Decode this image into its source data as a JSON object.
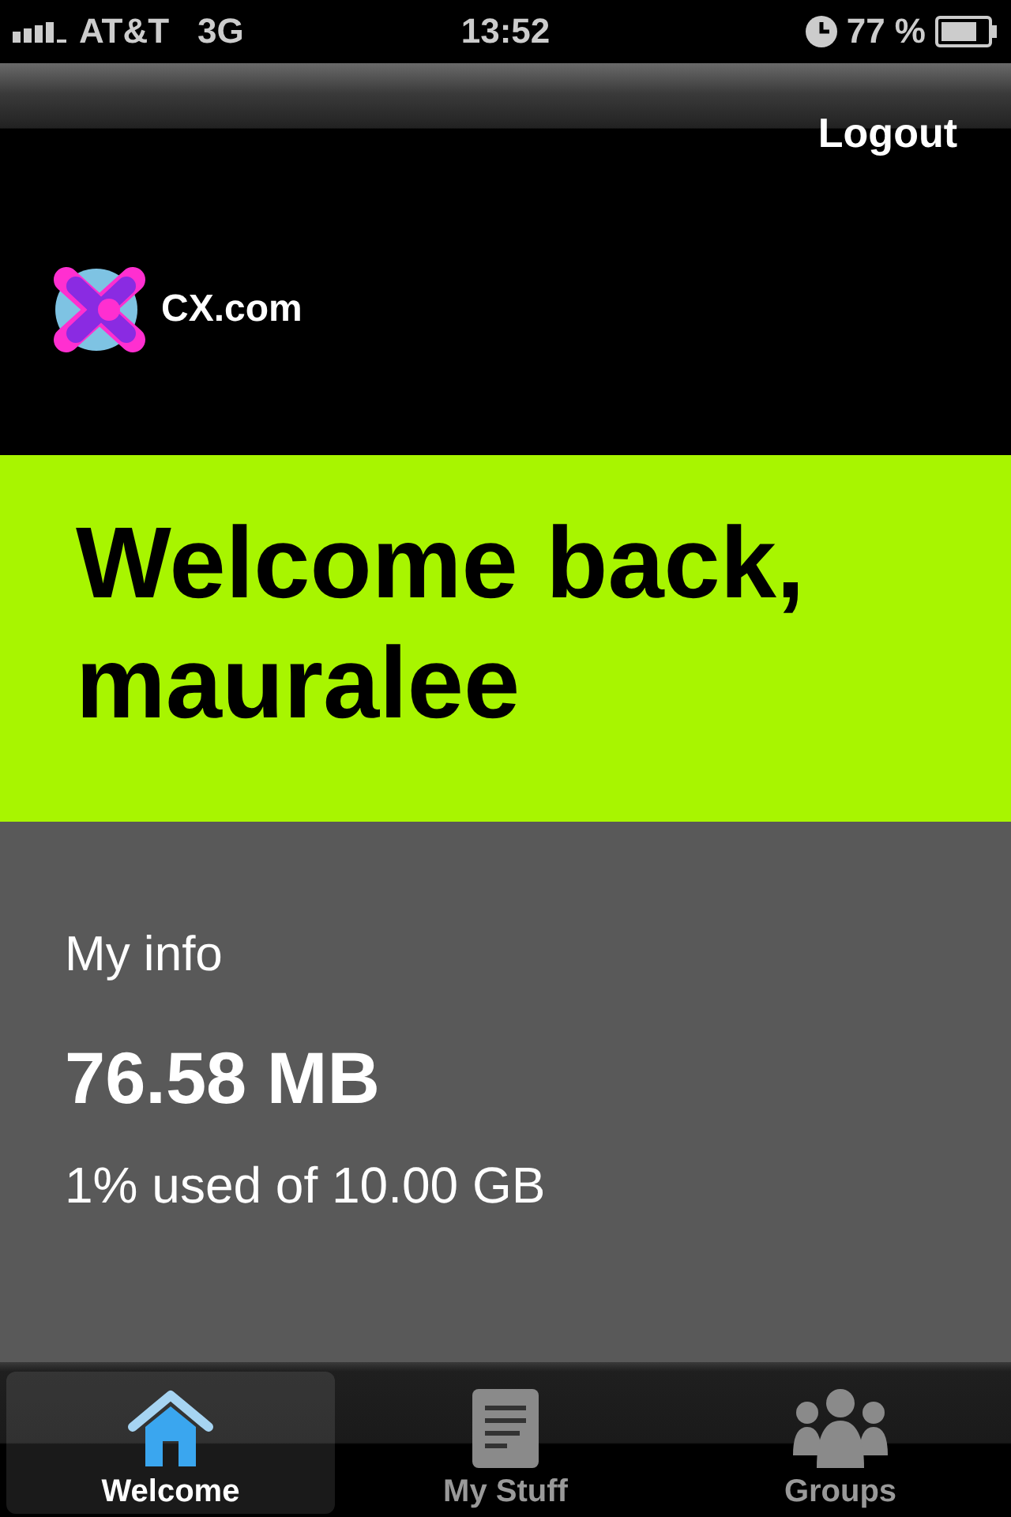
{
  "status_bar": {
    "carrier": "AT&T",
    "network": "3G",
    "time": "13:52",
    "battery": "77 %"
  },
  "nav": {
    "logout": "Logout"
  },
  "logo": {
    "name": "CX.com"
  },
  "welcome": {
    "title": "Welcome back, mauralee"
  },
  "info": {
    "heading": "My info",
    "amount": "76.58 MB",
    "usage": "1% used of 10.00 GB"
  },
  "tabs": [
    {
      "label": "Welcome",
      "kind": "home",
      "selected": true
    },
    {
      "label": "My Stuff",
      "kind": "document",
      "selected": false
    },
    {
      "label": "Groups",
      "kind": "people",
      "selected": false
    }
  ]
}
